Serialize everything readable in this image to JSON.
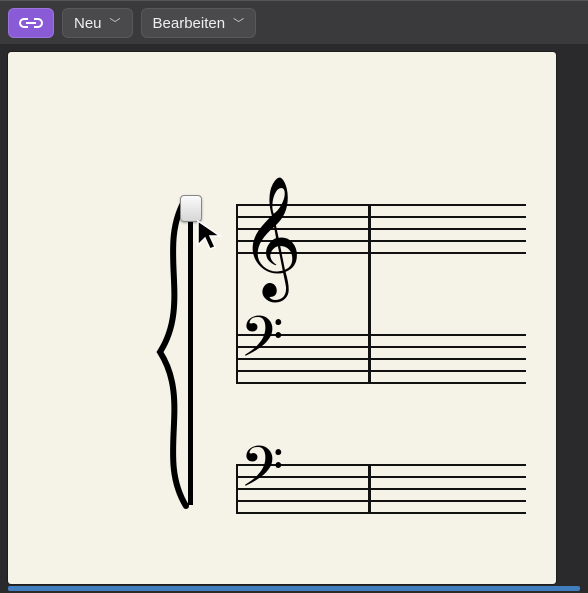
{
  "toolbar": {
    "new_label": "Neu",
    "edit_label": "Bearbeiten"
  },
  "score": {
    "staves": [
      {
        "clef": "treble",
        "clef_glyph": "𝄞"
      },
      {
        "clef": "bass",
        "clef_glyph": "𝄢"
      },
      {
        "clef": "bass",
        "clef_glyph": "𝄢"
      }
    ]
  }
}
